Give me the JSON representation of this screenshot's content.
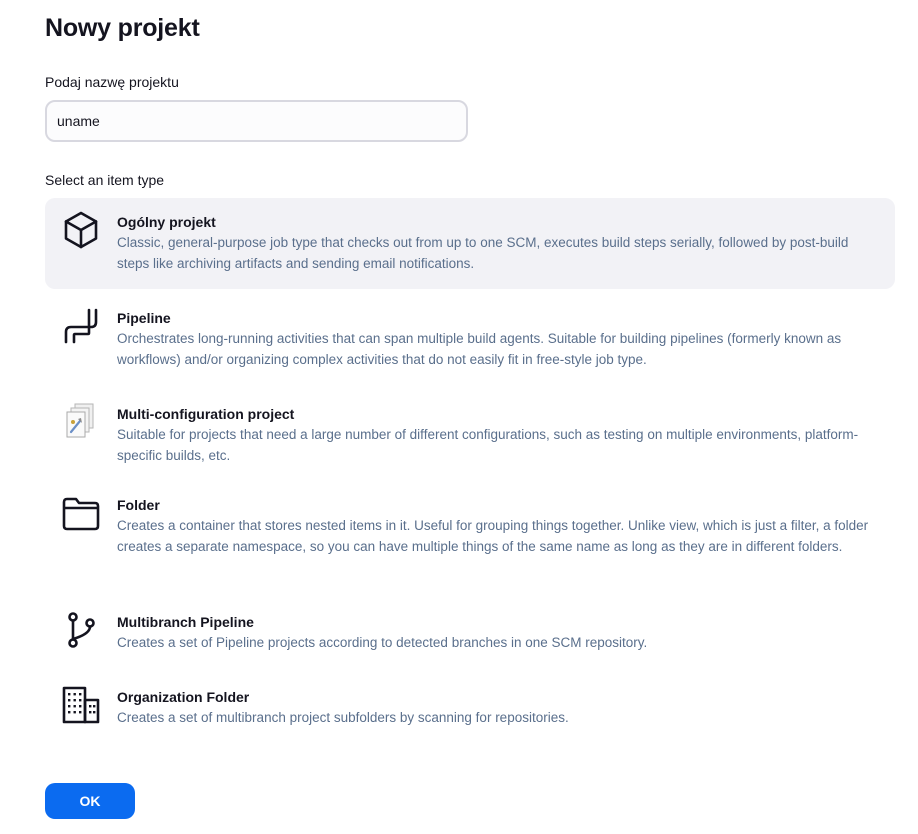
{
  "page": {
    "title": "Nowy projekt",
    "name_label": "Podaj nazwę projektu",
    "name_value": "uname",
    "type_label": "Select an item type"
  },
  "items": [
    {
      "title": "Ogólny projekt",
      "description": "Classic, general-purpose job type that checks out from up to one SCM, executes build steps serially, followed by post-build steps like archiving artifacts and sending email notifications.",
      "icon": "package-icon",
      "selected": true
    },
    {
      "title": "Pipeline",
      "description": "Orchestrates long-running activities that can span multiple build agents. Suitable for building pipelines (formerly known as workflows) and/or organizing complex activities that do not easily fit in free-style job type.",
      "icon": "pipeline-icon",
      "selected": false
    },
    {
      "title": "Multi-configuration project",
      "description": "Suitable for projects that need a large number of different configurations, such as testing on multiple environments, platform-specific builds, etc.",
      "icon": "multi-config-icon",
      "selected": false
    },
    {
      "title": "Folder",
      "description": "Creates a container that stores nested items in it. Useful for grouping things together. Unlike view, which is just a filter, a folder creates a separate namespace, so you can have multiple things of the same name as long as they are in different folders.",
      "icon": "folder-icon",
      "selected": false
    },
    {
      "title": "Multibranch Pipeline",
      "description": "Creates a set of Pipeline projects according to detected branches in one SCM repository.",
      "icon": "branch-icon",
      "selected": false
    },
    {
      "title": "Organization Folder",
      "description": "Creates a set of multibranch project subfolders by scanning for repositories.",
      "icon": "building-icon",
      "selected": false
    }
  ],
  "ok_label": "OK",
  "colors": {
    "accent": "#0b6bf0",
    "selected_bg": "#f2f2f6",
    "description_text": "#5a6f8c"
  }
}
